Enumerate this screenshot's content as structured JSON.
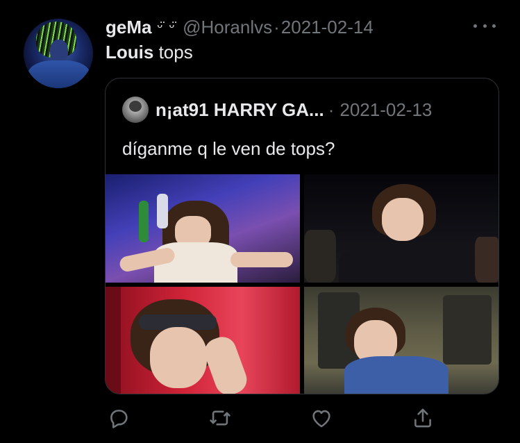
{
  "tweet": {
    "author_name": "geMa",
    "author_emoji": "ᵕ̈ ᵕ̈",
    "handle": "@Horanlvs",
    "separator": "·",
    "date": "2021-02-14",
    "text_name": "Louis",
    "text_rest": " tops"
  },
  "quote": {
    "author_name": "n¡at91 HARRY GA...",
    "separator": "·",
    "date": "2021-02-13",
    "text": "díganme q le ven de tops?"
  },
  "icons": {
    "more": "more-icon",
    "reply": "reply-icon",
    "retweet": "retweet-icon",
    "like": "like-icon",
    "share": "share-icon"
  },
  "colors": {
    "background": "#000000",
    "text": "#e7e9ea",
    "muted": "#71767b",
    "border": "#2f3336"
  }
}
